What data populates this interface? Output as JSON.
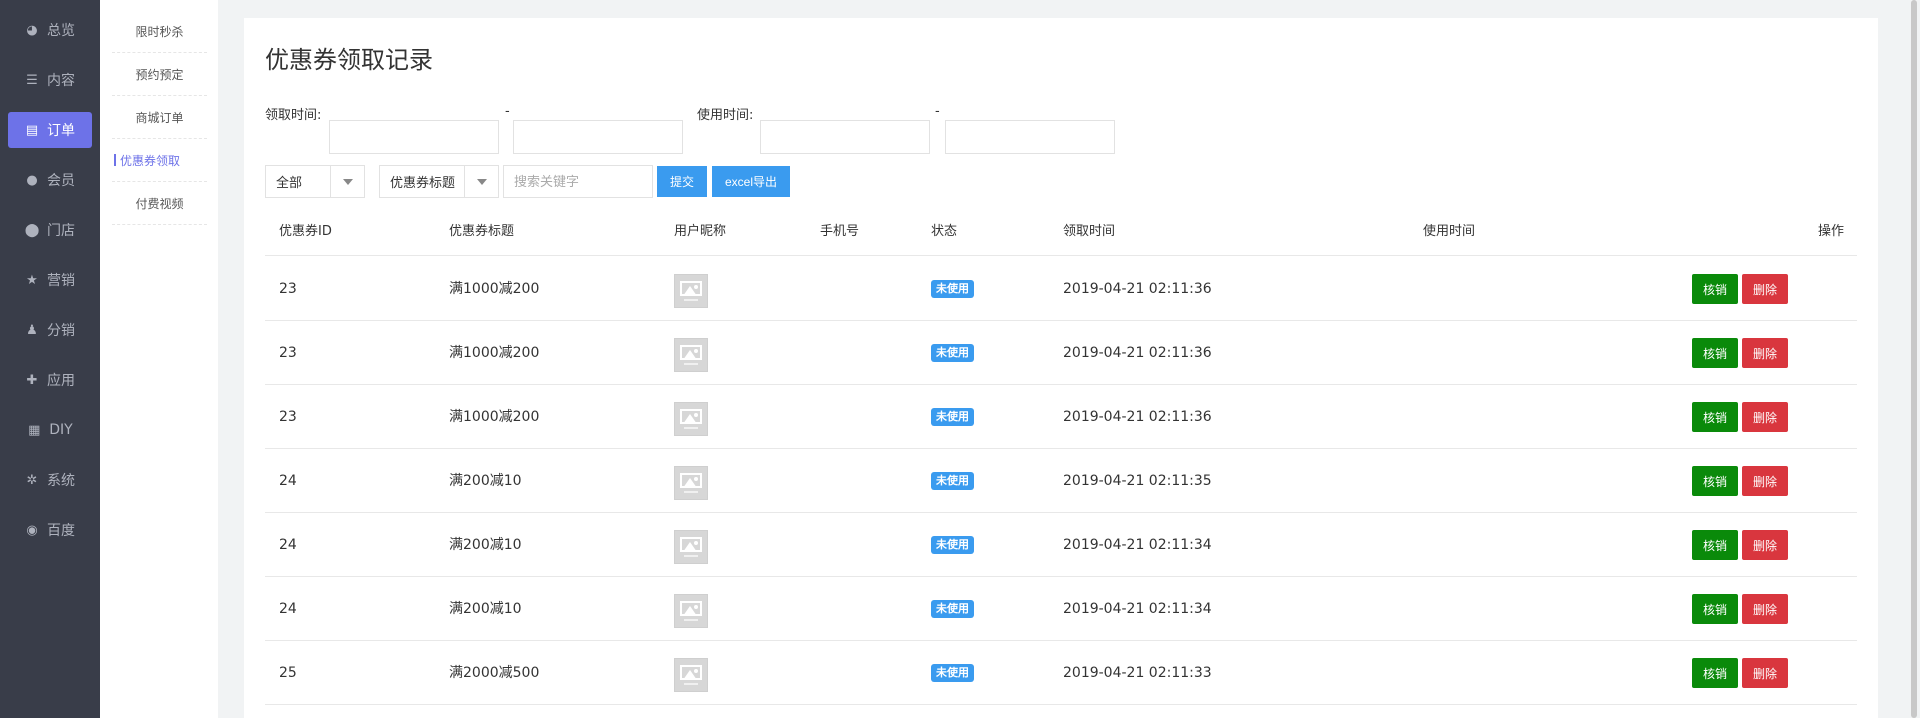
{
  "nav": [
    {
      "label": "总览",
      "icon": "pie-chart-icon",
      "glyph": "◕",
      "active": false
    },
    {
      "label": "内容",
      "icon": "list-icon",
      "glyph": "☰",
      "active": false
    },
    {
      "label": "订单",
      "icon": "document-icon",
      "glyph": "▤",
      "active": true
    },
    {
      "label": "会员",
      "icon": "user-icon",
      "glyph": "●",
      "active": false
    },
    {
      "label": "门店",
      "icon": "map-pin-icon",
      "glyph": "⬤",
      "active": false
    },
    {
      "label": "营销",
      "icon": "star-icon",
      "glyph": "★",
      "active": false
    },
    {
      "label": "分销",
      "icon": "users-icon",
      "glyph": "♟",
      "active": false
    },
    {
      "label": "应用",
      "icon": "puzzle-icon",
      "glyph": "✚",
      "active": false
    },
    {
      "label": "DIY",
      "icon": "layout-icon",
      "glyph": "▦",
      "active": false
    },
    {
      "label": "系统",
      "icon": "gear-icon",
      "glyph": "✲",
      "active": false
    },
    {
      "label": "百度",
      "icon": "compass-icon",
      "glyph": "◉",
      "active": false
    }
  ],
  "subnav": [
    {
      "label": "限时秒杀",
      "active": false
    },
    {
      "label": "预约预定",
      "active": false
    },
    {
      "label": "商城订单",
      "active": false
    },
    {
      "label": "优惠券领取",
      "active": true
    },
    {
      "label": "付费视频",
      "active": false
    }
  ],
  "page": {
    "title": "优惠券领取记录"
  },
  "filters": {
    "receive_time_label": "领取时间:",
    "use_time_label": "使用时间:",
    "range_separator": "-",
    "receive_start": "",
    "receive_end": "",
    "use_start": "",
    "use_end": "",
    "status_select": "全部",
    "field_select": "优惠券标题",
    "search_placeholder": "搜索关键字",
    "submit_label": "提交",
    "export_label": "excel导出"
  },
  "table": {
    "columns": [
      "优惠券ID",
      "优惠券标题",
      "用户昵称",
      "手机号",
      "状态",
      "领取时间",
      "使用时间",
      "操作"
    ],
    "verify_label": "核销",
    "delete_label": "删除",
    "rows": [
      {
        "id": "23",
        "title": "满1000减200",
        "phone": "",
        "status": "未使用",
        "receive_time": "2019-04-21 02:11:36",
        "use_time": ""
      },
      {
        "id": "23",
        "title": "满1000减200",
        "phone": "",
        "status": "未使用",
        "receive_time": "2019-04-21 02:11:36",
        "use_time": ""
      },
      {
        "id": "23",
        "title": "满1000减200",
        "phone": "",
        "status": "未使用",
        "receive_time": "2019-04-21 02:11:36",
        "use_time": ""
      },
      {
        "id": "24",
        "title": "满200减10",
        "phone": "",
        "status": "未使用",
        "receive_time": "2019-04-21 02:11:35",
        "use_time": ""
      },
      {
        "id": "24",
        "title": "满200减10",
        "phone": "",
        "status": "未使用",
        "receive_time": "2019-04-21 02:11:34",
        "use_time": ""
      },
      {
        "id": "24",
        "title": "满200减10",
        "phone": "",
        "status": "未使用",
        "receive_time": "2019-04-21 02:11:34",
        "use_time": ""
      },
      {
        "id": "25",
        "title": "满2000减500",
        "phone": "",
        "status": "未使用",
        "receive_time": "2019-04-21 02:11:33",
        "use_time": ""
      }
    ]
  },
  "colors": {
    "nav_bg": "#393d49",
    "accent": "#6d72e8",
    "primary_button": "#3a9bef",
    "verify_button": "#0a8a0a",
    "delete_button": "#d9363e"
  }
}
